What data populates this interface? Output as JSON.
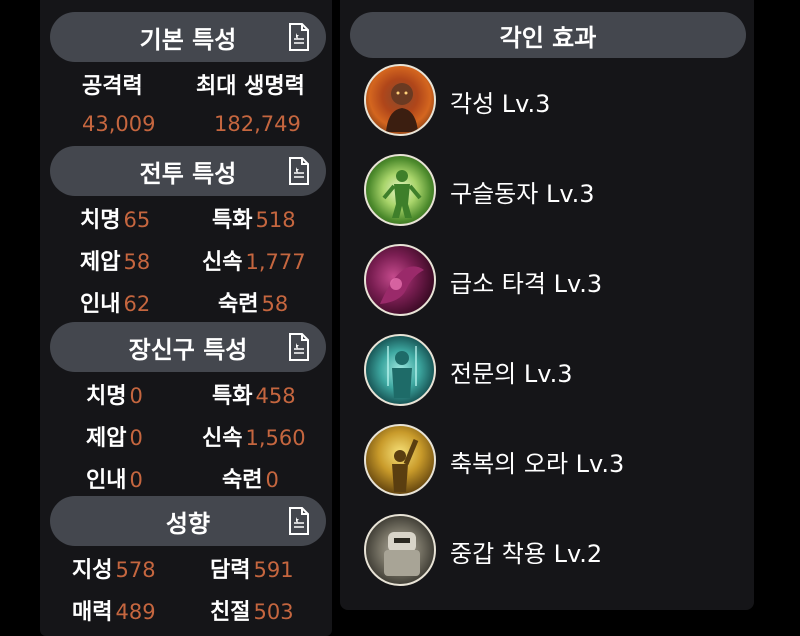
{
  "basic": {
    "title": "기본 특성",
    "attack_label": "공격력",
    "attack_value": "43,009",
    "hp_label": "최대 생명력",
    "hp_value": "182,749"
  },
  "combat": {
    "title": "전투 특성",
    "stats": [
      {
        "label": "치명",
        "value": "65"
      },
      {
        "label": "특화",
        "value": "518"
      },
      {
        "label": "제압",
        "value": "58"
      },
      {
        "label": "신속",
        "value": "1,777"
      },
      {
        "label": "인내",
        "value": "62"
      },
      {
        "label": "숙련",
        "value": "58"
      }
    ]
  },
  "accessory": {
    "title": "장신구 특성",
    "stats": [
      {
        "label": "치명",
        "value": "0"
      },
      {
        "label": "특화",
        "value": "458"
      },
      {
        "label": "제압",
        "value": "0"
      },
      {
        "label": "신속",
        "value": "1,560"
      },
      {
        "label": "인내",
        "value": "0"
      },
      {
        "label": "숙련",
        "value": "0"
      }
    ]
  },
  "tendency": {
    "title": "성향",
    "stats": [
      {
        "label": "지성",
        "value": "578"
      },
      {
        "label": "담력",
        "value": "591"
      },
      {
        "label": "매력",
        "value": "489"
      },
      {
        "label": "친절",
        "value": "503"
      }
    ]
  },
  "engraving": {
    "title": "각인 효과",
    "effects": [
      {
        "name": "각성 Lv.3",
        "icon": "awakening-icon"
      },
      {
        "name": "구슬동자 Lv.3",
        "icon": "orb-boy-icon"
      },
      {
        "name": "급소 타격 Lv.3",
        "icon": "vital-strike-icon"
      },
      {
        "name": "전문의 Lv.3",
        "icon": "specialist-icon"
      },
      {
        "name": "축복의 오라 Lv.3",
        "icon": "blessed-aura-icon"
      },
      {
        "name": "중갑 착용 Lv.2",
        "icon": "heavy-armor-icon"
      }
    ]
  }
}
